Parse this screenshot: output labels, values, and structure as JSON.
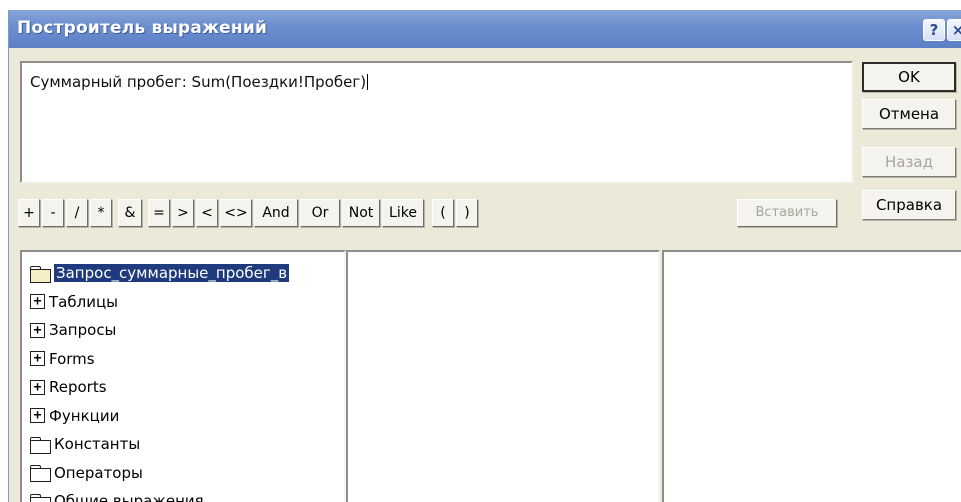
{
  "window": {
    "title": "Построитель выражений",
    "help_label": "?",
    "close_label": "×"
  },
  "expression": {
    "value": "Суммарный пробег: Sum(Поездки!Пробег)"
  },
  "buttons": {
    "ok": "OK",
    "cancel": "Отмена",
    "back": "Назад",
    "help": "Справка",
    "insert": "Вставить"
  },
  "operators": [
    "+",
    "-",
    "/",
    "*",
    "&",
    "=",
    ">",
    "<",
    "<>",
    "And",
    "Or",
    "Not",
    "Like",
    "(",
    ")"
  ],
  "tree": {
    "items": [
      {
        "label": "Запрос_суммарные_пробег_в",
        "icon": "folder-open-icon",
        "selected": true
      },
      {
        "label": "Таблицы",
        "icon": "expand-plus-icon"
      },
      {
        "label": "Запросы",
        "icon": "expand-plus-icon"
      },
      {
        "label": "Forms",
        "icon": "expand-plus-icon"
      },
      {
        "label": "Reports",
        "icon": "expand-plus-icon"
      },
      {
        "label": "Функции",
        "icon": "expand-plus-icon"
      },
      {
        "label": "Константы",
        "icon": "folder-icon"
      },
      {
        "label": "Операторы",
        "icon": "folder-icon"
      },
      {
        "label": "Общие выражения",
        "icon": "folder-icon"
      }
    ]
  },
  "colors": {
    "titlebar": "#6d8fcf",
    "selection": "#1f3a7d",
    "dialog_bg": "#ece9d8"
  }
}
